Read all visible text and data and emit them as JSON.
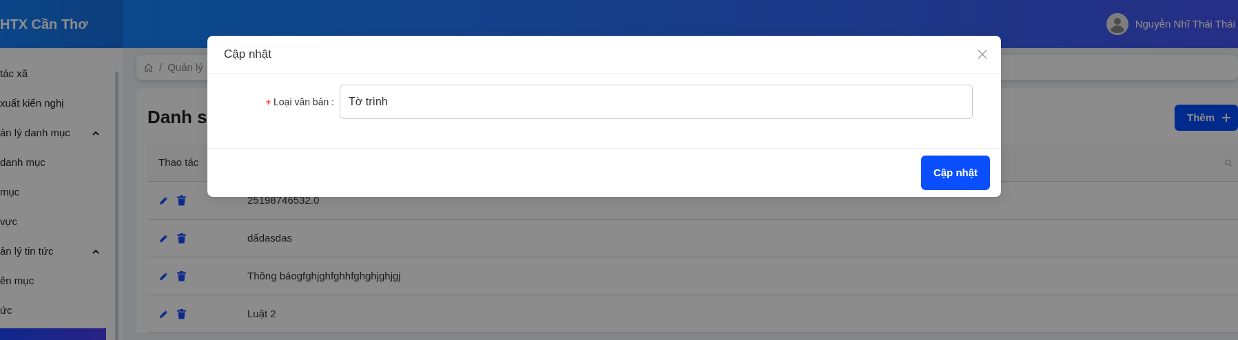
{
  "header": {
    "brand": "HTX Cần Thơ",
    "user_name": "Nguyễn Nhĩ Thái Thái"
  },
  "sidebar": {
    "items": [
      {
        "kind": "link",
        "label": "tác xã",
        "selected": false
      },
      {
        "kind": "link",
        "label": "xuất kiến nghị",
        "selected": false
      },
      {
        "kind": "group",
        "label": "ản lý danh mục",
        "expanded": true,
        "selected": false
      },
      {
        "kind": "link",
        "label": "danh mục",
        "selected": false
      },
      {
        "kind": "link",
        "label": "mục",
        "selected": false
      },
      {
        "kind": "link",
        "label": "vực",
        "selected": false
      },
      {
        "kind": "group",
        "label": "ản lý tin tức",
        "expanded": true,
        "selected": false
      },
      {
        "kind": "link",
        "label": "ên mục",
        "selected": false
      },
      {
        "kind": "link",
        "label": "ức",
        "selected": false
      },
      {
        "kind": "link",
        "selected": true
      }
    ]
  },
  "breadcrumb": {
    "separator": "/",
    "items": [
      "Quản lý"
    ]
  },
  "page": {
    "title": "Danh s",
    "add_button": "Thêm"
  },
  "table": {
    "columns": [
      {
        "label": "Thao tác"
      }
    ],
    "rows": [
      {
        "column_2": "25198746532.0"
      },
      {
        "column_2": "dấdasdas"
      },
      {
        "column_2": "Thông báogfghjghfghhfghghjghjgj"
      },
      {
        "column_2": "Luật 2"
      }
    ]
  },
  "modal": {
    "title": "Cập nhật",
    "field": {
      "label": "Loại văn bản :",
      "required": true,
      "value": "Tờ trình"
    },
    "submit": "Cập nhật"
  }
}
